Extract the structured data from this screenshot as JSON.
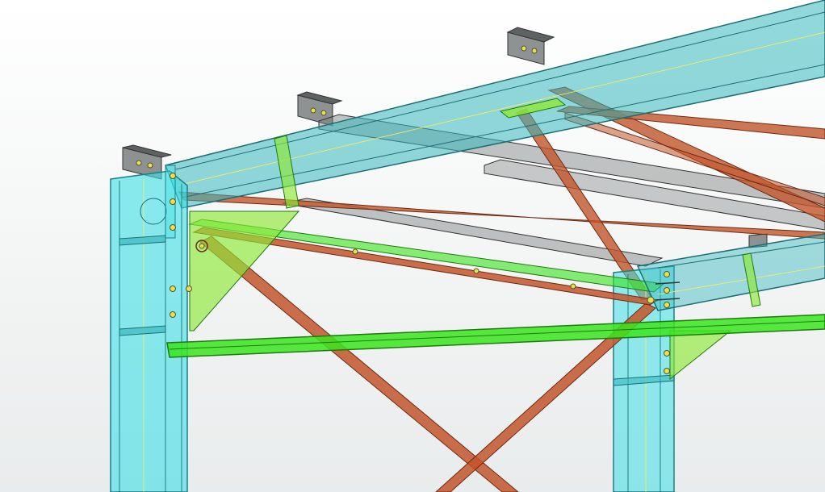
{
  "viewport": {
    "background_top": "#ffffff",
    "background_bottom": "#e9ecec"
  },
  "colors": {
    "column_fill": "#3ee0e6",
    "column_edge": "#1b7f86",
    "beam_fill": "#36b8be",
    "beam_edge": "#1d6e74",
    "brace_fill": "#c2552b",
    "brace_edge": "#6e2a12",
    "green_fill": "#39e51d",
    "green_edge": "#1f7a10",
    "gusset_fill": "#8ee836",
    "purlin_fill": "#7a7f7f",
    "purlin_edge": "#333333",
    "bolt_fill": "#e8e05a",
    "bolt_edge": "#555522",
    "centerline": "#ffee55"
  },
  "model": {
    "columns": [
      {
        "name": "column-left"
      },
      {
        "name": "column-right"
      }
    ],
    "rafter_beams": [
      {
        "name": "rafter-beam-front"
      },
      {
        "name": "rafter-beam-side"
      }
    ],
    "purlin_cleats": 4,
    "eave_struts": [
      {
        "name": "eave-strut-lower"
      },
      {
        "name": "eave-strut-upper"
      }
    ],
    "cross_braces": 6,
    "knee_plates": 2,
    "bolt_groups": 8
  }
}
